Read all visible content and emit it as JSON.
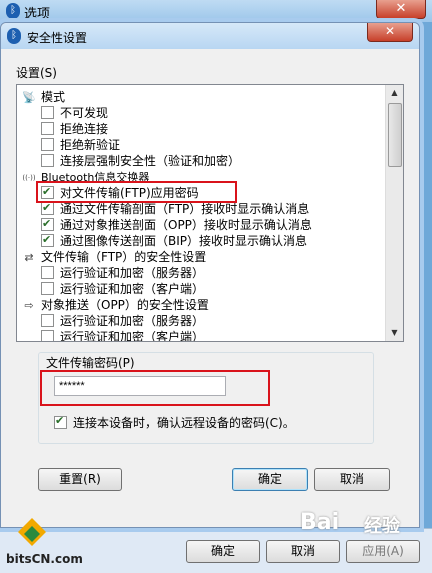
{
  "outer": {
    "title": "选项",
    "close_icon": "✕",
    "buttons": [
      "确定",
      "取消",
      "应用(A)"
    ]
  },
  "dialog": {
    "title": "安全性设置",
    "close_icon": "✕",
    "settings_label": "设置(S)",
    "tree": [
      {
        "type": "group",
        "label": "模式",
        "icon": "satellite-icon"
      },
      {
        "type": "item",
        "label": "不可发现",
        "checked": false
      },
      {
        "type": "item",
        "label": "拒绝连接",
        "checked": false
      },
      {
        "type": "item",
        "label": "拒绝新验证",
        "checked": false
      },
      {
        "type": "item",
        "label": "连接层强制安全性（验证和加密）",
        "checked": false
      },
      {
        "type": "group",
        "label": "Bluetooth信息交换器",
        "icon": "signal-icon"
      },
      {
        "type": "item",
        "label": "对文件传输(FTP)应用密码",
        "checked": true
      },
      {
        "type": "item",
        "label": "通过文件传输剖面（FTP）接收时显示确认消息",
        "checked": true
      },
      {
        "type": "item",
        "label": "通过对象推送剖面（OPP）接收时显示确认消息",
        "checked": true
      },
      {
        "type": "item",
        "label": "通过图像传送剖面（BIP）接收时显示确认消息",
        "checked": true
      },
      {
        "type": "group",
        "label": "文件传输（FTP）的安全性设置",
        "icon": "transfer-icon"
      },
      {
        "type": "item",
        "label": "运行验证和加密（服务器）",
        "checked": false
      },
      {
        "type": "item",
        "label": "运行验证和加密（客户端）",
        "checked": false
      },
      {
        "type": "group",
        "label": "对象推送（OPP）的安全性设置",
        "icon": "push-icon"
      },
      {
        "type": "item",
        "label": "运行验证和加密（服务器）",
        "checked": false
      },
      {
        "type": "item",
        "label": "运行验证和加密（客户端）",
        "checked": false
      }
    ],
    "ftp_password_label": "文件传输密码(P)",
    "ftp_password_value": "******",
    "confirm_remote_label": "连接本设备时，确认远程设备的密码(C)。",
    "confirm_remote_checked": true,
    "reset_button": "重置(R)",
    "ok_button": "确定",
    "cancel_button": "取消"
  },
  "watermarks": {
    "bitscn": "bitsCN.com",
    "baidu": "Bai",
    "baidu2": "经验"
  }
}
